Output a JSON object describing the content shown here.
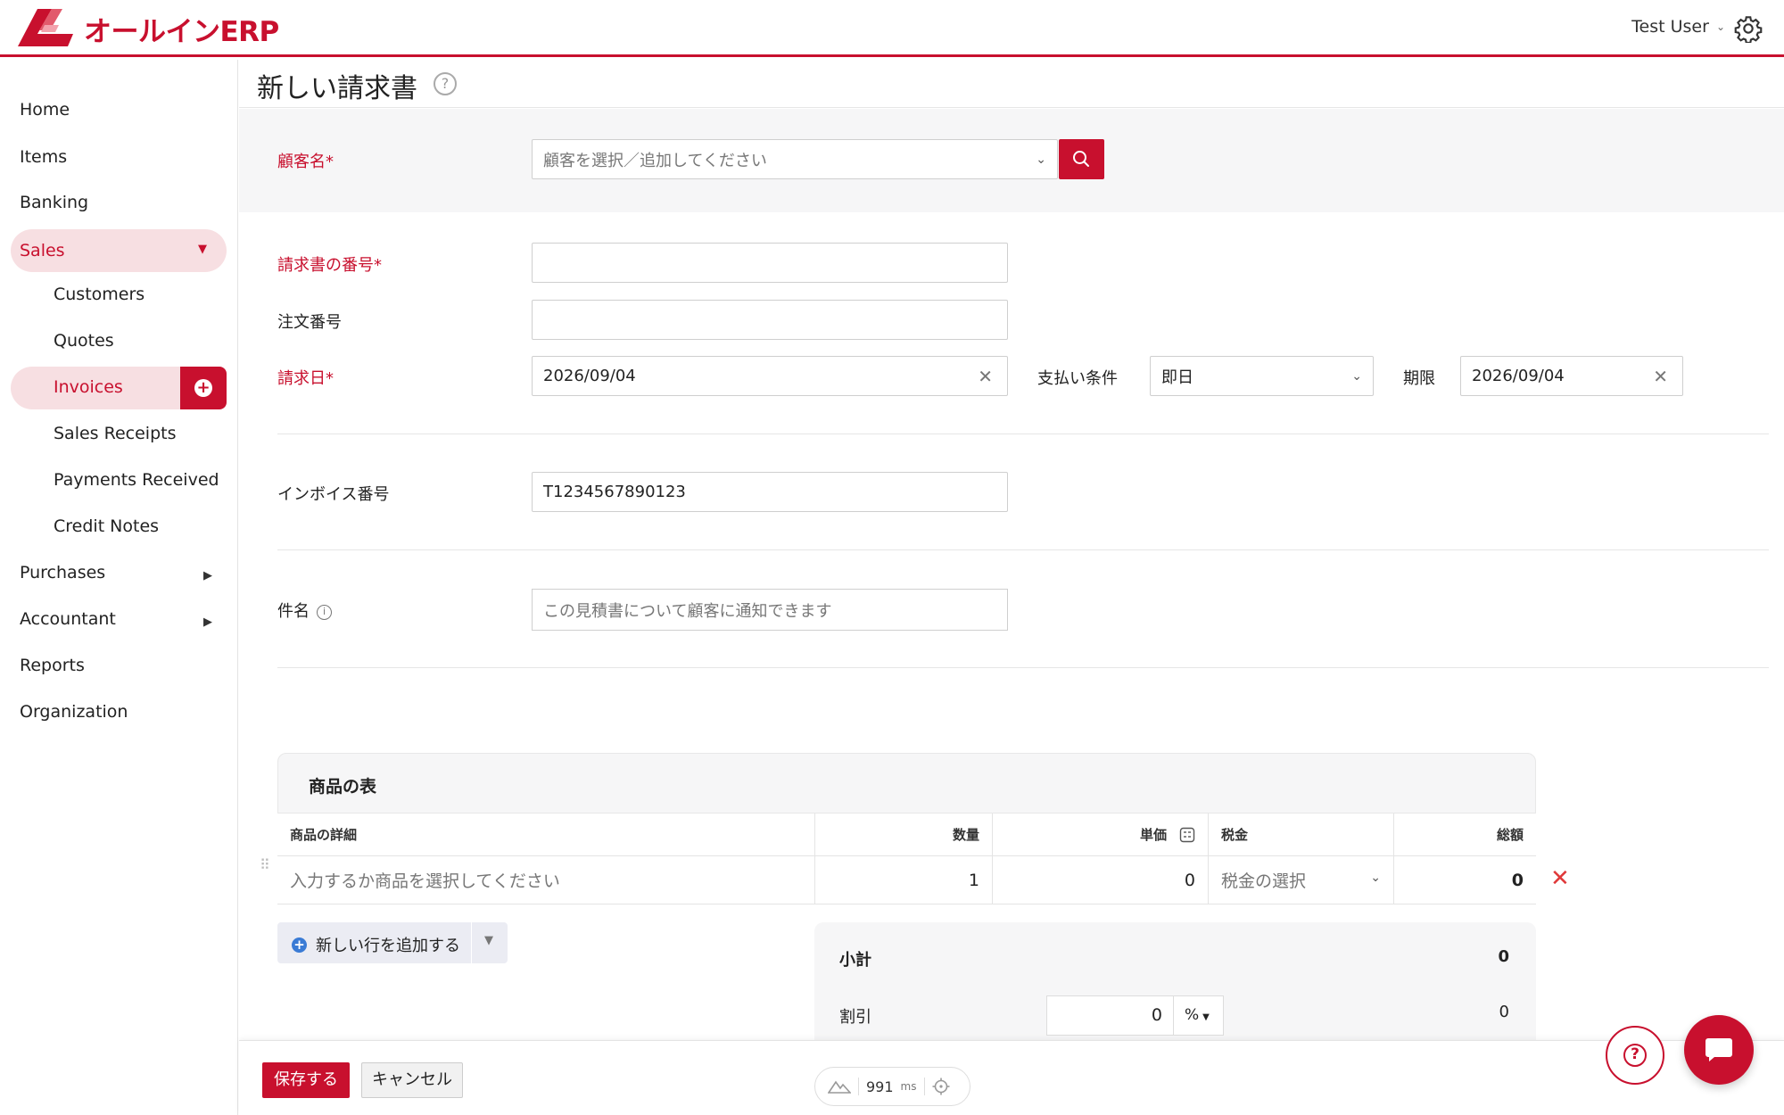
{
  "brand": {
    "logo_text": "オールインERP",
    "accent": "#c8102e"
  },
  "header": {
    "user_name": "Test User"
  },
  "sidebar": {
    "items": [
      {
        "label": "Home"
      },
      {
        "label": "Items"
      },
      {
        "label": "Banking"
      },
      {
        "label": "Sales"
      },
      {
        "label": "Purchases"
      },
      {
        "label": "Accountant"
      },
      {
        "label": "Reports"
      },
      {
        "label": "Organization"
      }
    ],
    "sales_sub": [
      {
        "label": "Customers"
      },
      {
        "label": "Quotes"
      },
      {
        "label": "Invoices"
      },
      {
        "label": "Sales Receipts"
      },
      {
        "label": "Payments Received"
      },
      {
        "label": "Credit Notes"
      }
    ]
  },
  "page": {
    "title": "新しい請求書"
  },
  "form": {
    "customer_label": "顧客名*",
    "customer_placeholder": "顧客を選択／追加してください",
    "invoice_no_label": "請求書の番号*",
    "order_no_label": "注文番号",
    "invoice_date_label": "請求日*",
    "invoice_date": "2026/09/04",
    "terms_label": "支払い条件",
    "terms_value": "即日",
    "due_label": "期限",
    "due_date": "2026/09/04",
    "registration_label": "インボイス番号",
    "registration_value": "T1234567890123",
    "subject_label": "件名",
    "subject_placeholder": "この見積書について顧客に通知できます"
  },
  "items_table": {
    "title": "商品の表",
    "columns": [
      "商品の詳細",
      "数量",
      "単価",
      "税金",
      "総額"
    ],
    "rows": [
      {
        "item_placeholder": "入力するか商品を選択してください",
        "qty": "1",
        "rate": "0",
        "tax_placeholder": "税金の選択",
        "amount": "0"
      }
    ],
    "add_row_label": "新しい行を追加する"
  },
  "totals": {
    "subtotal_label": "小計",
    "subtotal": "0",
    "discount_label": "割引",
    "discount_input": "0",
    "discount_unit": "%",
    "discount_amount": "0"
  },
  "footer": {
    "save_label": "保存する",
    "cancel_label": "キャンセル",
    "perf_value": "991",
    "perf_unit": "ms"
  },
  "icons": {
    "search": "search-icon",
    "settings": "gear-icon",
    "help": "help-icon",
    "chat": "chat-icon",
    "clear": "close-icon",
    "delete_row": "close-icon"
  }
}
